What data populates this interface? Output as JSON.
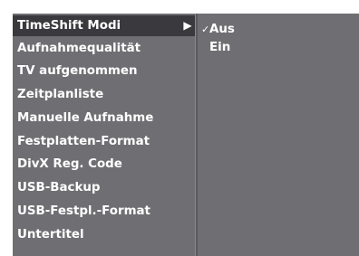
{
  "menu": {
    "items": [
      {
        "label": "TimeShift Modi",
        "selected": true
      },
      {
        "label": "Aufnahmequalität"
      },
      {
        "label": "TV aufgenommen"
      },
      {
        "label": "Zeitplanliste"
      },
      {
        "label": "Manuelle Aufnahme"
      },
      {
        "label": "Festplatten-Format"
      },
      {
        "label": "DivX Reg. Code"
      },
      {
        "label": "USB-Backup"
      },
      {
        "label": "USB-Festpl.-Format"
      },
      {
        "label": "Untertitel"
      }
    ],
    "submenu_arrow_icon": "triangle-right-icon"
  },
  "submenu": {
    "options": [
      {
        "label": "Aus",
        "checked": true
      },
      {
        "label": "Ein",
        "checked": false
      }
    ],
    "check_icon": "checkmark-icon"
  },
  "colors": {
    "panel": "#6f6f73",
    "selected": "#3a3a3e",
    "text": "#ffffff"
  }
}
